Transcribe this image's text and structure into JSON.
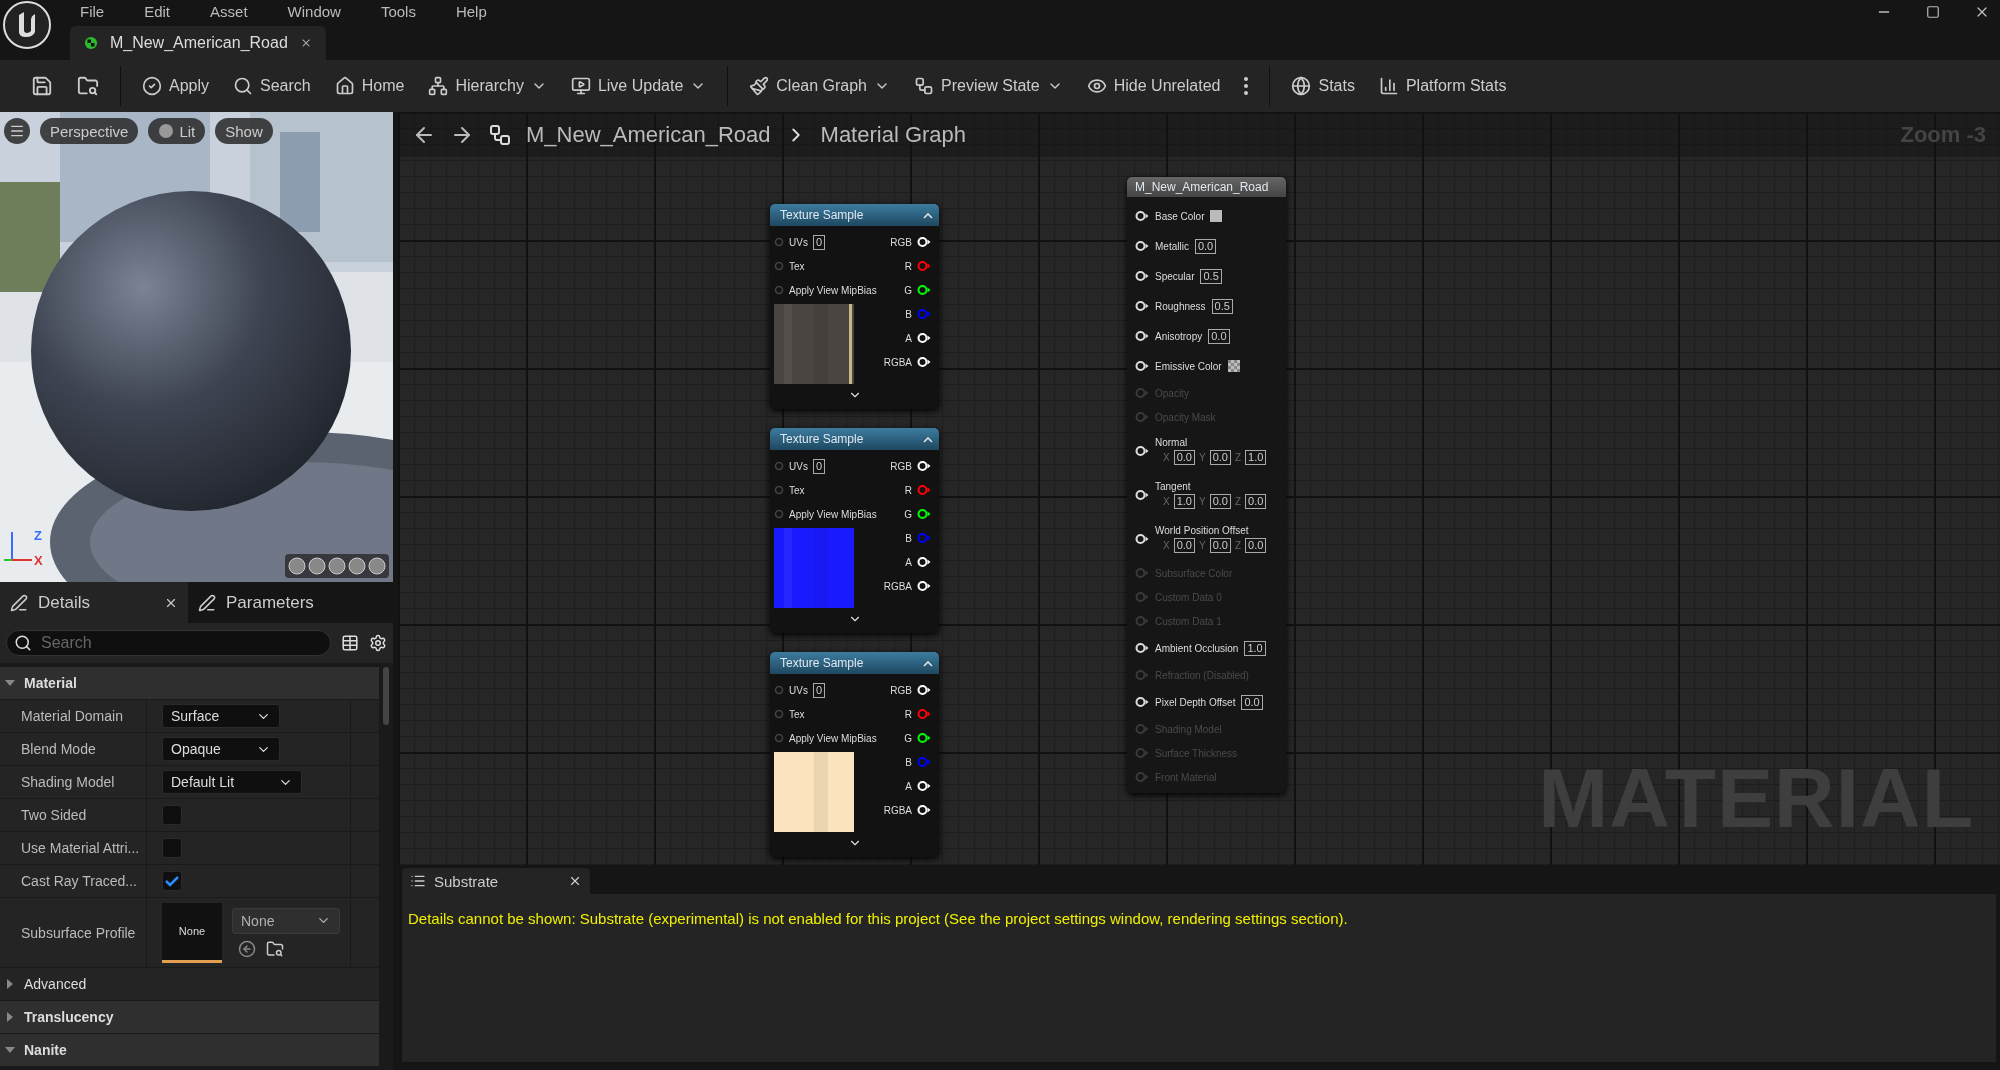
{
  "menu": [
    "File",
    "Edit",
    "Asset",
    "Window",
    "Tools",
    "Help"
  ],
  "document_tab": {
    "title": "M_New_American_Road"
  },
  "toolbar": [
    [
      {
        "kind": "button",
        "label": "Apply",
        "dropdown": false
      },
      {
        "kind": "button",
        "label": "Search",
        "dropdown": false
      },
      {
        "kind": "button",
        "label": "Home",
        "dropdown": false
      },
      {
        "kind": "button",
        "label": "Hierarchy",
        "dropdown": true
      },
      {
        "kind": "button",
        "label": "Live Update",
        "dropdown": true
      }
    ],
    [
      {
        "kind": "button",
        "label": "Clean Graph",
        "dropdown": true
      },
      {
        "kind": "button",
        "label": "Preview State",
        "dropdown": true
      },
      {
        "kind": "button",
        "label": "Hide Unrelated",
        "dropdown": false
      },
      {
        "kind": "overflow"
      }
    ],
    [
      {
        "kind": "button",
        "label": "Stats",
        "dropdown": false
      },
      {
        "kind": "button",
        "label": "Platform Stats",
        "dropdown": false
      }
    ]
  ],
  "viewport": {
    "buttons": [
      {
        "label": "Perspective"
      },
      {
        "label": "Lit"
      },
      {
        "label": "Show"
      }
    ],
    "axes": [
      "Z",
      "X"
    ]
  },
  "details": {
    "tabs": [
      {
        "label": "Details",
        "selected": true
      },
      {
        "label": "Parameters",
        "selected": false
      }
    ],
    "search": {
      "placeholder": "Search"
    },
    "sections": [
      {
        "kind": "category",
        "title": "Material",
        "expanded": true,
        "rows": [
          {
            "kind": "dropdown",
            "label": "Material Domain",
            "value": "Surface"
          },
          {
            "kind": "dropdown",
            "label": "Blend Mode",
            "value": "Opaque"
          },
          {
            "kind": "dropdown",
            "label": "Shading Model",
            "value": "Default Lit"
          },
          {
            "kind": "checkbox",
            "label": "Two Sided",
            "checked": false
          },
          {
            "kind": "checkbox",
            "label": "Use Material Attri...",
            "checked": false
          },
          {
            "kind": "checkbox",
            "label": "Cast Ray Traced...",
            "checked": true
          },
          {
            "kind": "asset",
            "label": "Subsurface Profile",
            "thumbnail": "None",
            "value": "None"
          }
        ]
      },
      {
        "kind": "subsection",
        "title": "Advanced",
        "expanded": false
      },
      {
        "kind": "category",
        "title": "Translucency",
        "expanded": false
      },
      {
        "kind": "category",
        "title": "Nanite",
        "expanded": true
      }
    ]
  },
  "graph": {
    "breadcrumb": [
      "M_New_American_Road",
      "Material Graph"
    ],
    "zoom": "Zoom -3",
    "label": "MATERIAL",
    "texture_nodes": [
      {
        "title": "Texture Sample",
        "color": "#4a4540",
        "inputs": [
          {
            "label": "UVs",
            "value": "0"
          },
          {
            "label": "Tex"
          },
          {
            "label": "Apply View MipBias"
          }
        ],
        "outputs": [
          {
            "label": "RGB",
            "color": "#ffffff"
          },
          {
            "label": "R",
            "color": "#ff0000"
          },
          {
            "label": "G",
            "color": "#00ff00"
          },
          {
            "label": "B",
            "color": "#0000ff"
          },
          {
            "label": "A",
            "color": "#ffffff"
          },
          {
            "label": "RGBA",
            "color": "#ffffff"
          }
        ]
      },
      {
        "title": "Texture Sample",
        "color": "#1a1aff",
        "inputs": [
          {
            "label": "UVs",
            "value": "0"
          },
          {
            "label": "Tex"
          },
          {
            "label": "Apply View MipBias"
          }
        ],
        "outputs": [
          {
            "label": "RGB",
            "color": "#ffffff"
          },
          {
            "label": "R",
            "color": "#ff0000"
          },
          {
            "label": "G",
            "color": "#00ff00"
          },
          {
            "label": "B",
            "color": "#0000ff"
          },
          {
            "label": "A",
            "color": "#ffffff"
          },
          {
            "label": "RGBA",
            "color": "#ffffff"
          }
        ]
      },
      {
        "title": "Texture Sample",
        "color": "#fae3bd",
        "inputs": [
          {
            "label": "UVs",
            "value": "0"
          },
          {
            "label": "Tex"
          },
          {
            "label": "Apply View MipBias"
          }
        ],
        "outputs": [
          {
            "label": "RGB",
            "color": "#ffffff"
          },
          {
            "label": "R",
            "color": "#ff0000"
          },
          {
            "label": "G",
            "color": "#00ff00"
          },
          {
            "label": "B",
            "color": "#0000ff"
          },
          {
            "label": "A",
            "color": "#ffffff"
          },
          {
            "label": "RGBA",
            "color": "#ffffff"
          }
        ]
      }
    ],
    "result_node": {
      "title": "M_New_American_Road",
      "pins": [
        {
          "kind": "color",
          "label": "Base Color",
          "enabled": true
        },
        {
          "kind": "scalar",
          "label": "Metallic",
          "value": "0.0",
          "enabled": true
        },
        {
          "kind": "scalar",
          "label": "Specular",
          "value": "0.5",
          "enabled": true
        },
        {
          "kind": "scalar",
          "label": "Roughness",
          "value": "0.5",
          "enabled": true
        },
        {
          "kind": "scalar",
          "label": "Anisotropy",
          "value": "0.0",
          "enabled": true
        },
        {
          "kind": "checker",
          "label": "Emissive Color",
          "enabled": true
        },
        {
          "kind": "plain",
          "label": "Opacity",
          "enabled": false
        },
        {
          "kind": "plain",
          "label": "Opacity Mask",
          "enabled": false
        },
        {
          "kind": "vector",
          "label": "Normal",
          "enabled": true,
          "components": [
            {
              "axis": "X",
              "value": "0.0"
            },
            {
              "axis": "Y",
              "value": "0.0"
            },
            {
              "axis": "Z",
              "value": "1.0"
            }
          ]
        },
        {
          "kind": "vector",
          "label": "Tangent",
          "enabled": true,
          "components": [
            {
              "axis": "X",
              "value": "1.0"
            },
            {
              "axis": "Y",
              "value": "0.0"
            },
            {
              "axis": "Z",
              "value": "0.0"
            }
          ]
        },
        {
          "kind": "vector",
          "label": "World Position Offset",
          "enabled": true,
          "components": [
            {
              "axis": "X",
              "value": "0.0"
            },
            {
              "axis": "Y",
              "value": "0.0"
            },
            {
              "axis": "Z",
              "value": "0.0"
            }
          ]
        },
        {
          "kind": "plain",
          "label": "Subsurface Color",
          "enabled": false
        },
        {
          "kind": "plain",
          "label": "Custom Data 0",
          "enabled": false
        },
        {
          "kind": "plain",
          "label": "Custom Data 1",
          "enabled": false
        },
        {
          "kind": "scalar",
          "label": "Ambient Occlusion",
          "value": "1.0",
          "enabled": true
        },
        {
          "kind": "plain",
          "label": "Refraction (Disabled)",
          "enabled": false
        },
        {
          "kind": "scalar",
          "label": "Pixel Depth Offset",
          "value": "0.0",
          "enabled": true
        },
        {
          "kind": "plain",
          "label": "Shading Model",
          "enabled": false
        },
        {
          "kind": "plain",
          "label": "Surface Thickness",
          "enabled": false
        },
        {
          "kind": "plain",
          "label": "Front Material",
          "enabled": false
        }
      ]
    }
  },
  "substrate": {
    "tab": "Substrate",
    "message": "Details cannot be shown: Substrate (experimental) is not enabled for this project (See the project settings window, rendering settings section)."
  }
}
